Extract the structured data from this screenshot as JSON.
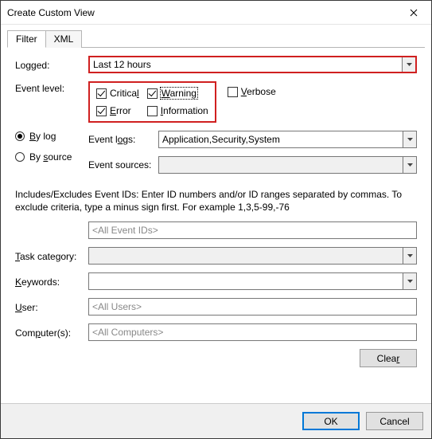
{
  "window": {
    "title": "Create Custom View"
  },
  "tabs": {
    "filter": "Filter",
    "xml": "XML"
  },
  "labels": {
    "logged": "Logged:",
    "event_level": "Event level:",
    "by_log": "By log",
    "by_source": "By source",
    "event_logs": "Event logs:",
    "event_sources": "Event sources:",
    "task_category": "Task category:",
    "keywords": "Keywords:",
    "user": "User:",
    "computers": "Computer(s):"
  },
  "logged": {
    "value": "Last 12 hours"
  },
  "levels": {
    "critical": {
      "label": "Critical",
      "checked": true
    },
    "warning": {
      "label": "Warning",
      "checked": true
    },
    "verbose": {
      "label": "Verbose",
      "checked": false
    },
    "error": {
      "label": "Error",
      "checked": true
    },
    "information": {
      "label": "Information",
      "checked": false
    }
  },
  "event_logs": {
    "value": "Application,Security,System"
  },
  "event_sources": {
    "value": ""
  },
  "info_text": "Includes/Excludes Event IDs: Enter ID numbers and/or ID ranges separated by commas. To exclude criteria, type a minus sign first. For example 1,3,5-99,-76",
  "event_ids": {
    "placeholder": "<All Event IDs>"
  },
  "task_category": {
    "value": ""
  },
  "keywords": {
    "value": ""
  },
  "user": {
    "placeholder": "<All Users>"
  },
  "computers": {
    "placeholder": "<All Computers>"
  },
  "buttons": {
    "clear": "Clear",
    "ok": "OK",
    "cancel": "Cancel"
  }
}
